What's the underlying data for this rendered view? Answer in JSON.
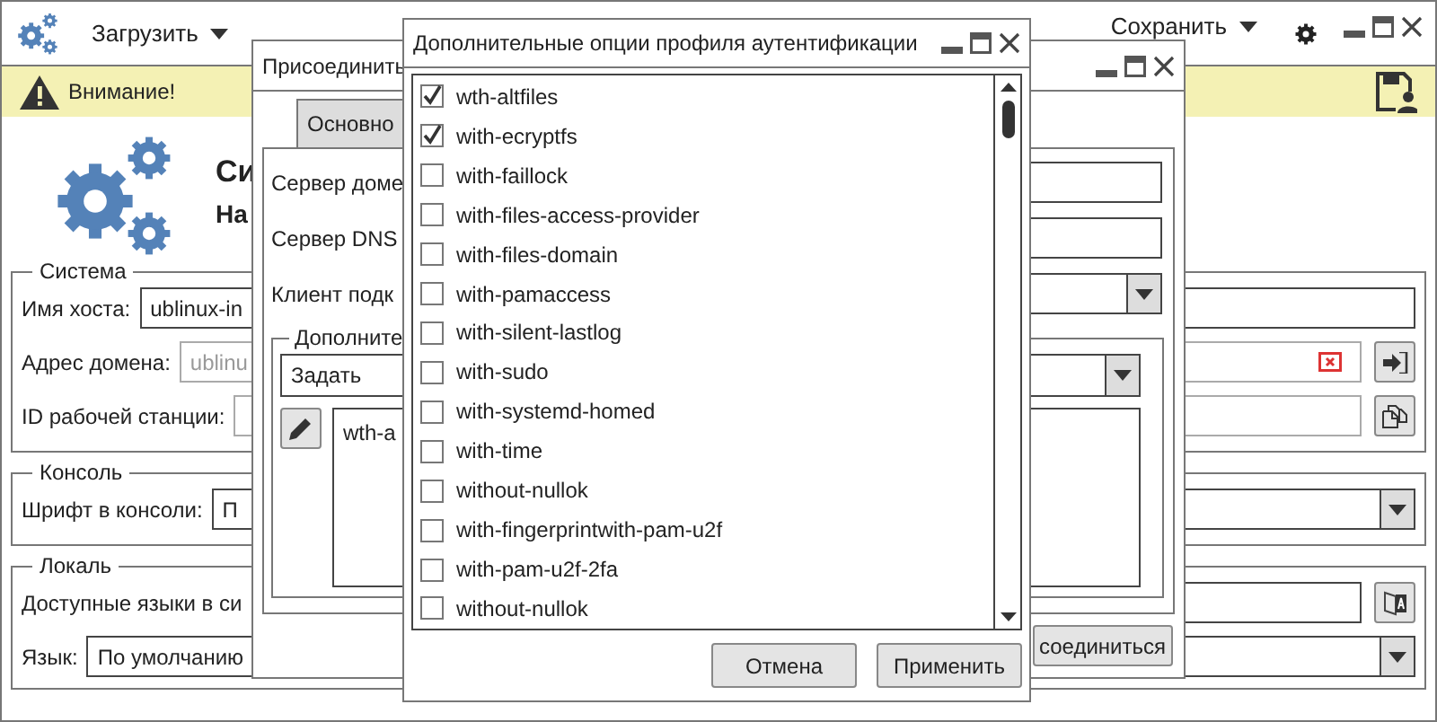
{
  "main": {
    "menu": [
      {
        "label": "Загрузить"
      }
    ],
    "save_menu": {
      "label": "Сохранить"
    },
    "warning": "Внимание!",
    "header_title": "Си",
    "header_subtitle": "На",
    "sections": [
      {
        "title": "Система",
        "rows": [
          {
            "kind": "text",
            "label": "Имя хоста:",
            "value": "ublinux-in"
          },
          {
            "kind": "clearable",
            "label": "Адрес домена:",
            "placeholder": "ublinu"
          },
          {
            "kind": "copy",
            "label": "ID рабочей станции:"
          }
        ]
      },
      {
        "title": "Консоль",
        "rows": [
          {
            "kind": "select",
            "label": "Шрифт в консоли:",
            "value": "П"
          }
        ]
      },
      {
        "title": "Локаль",
        "rows": [
          {
            "kind": "lang",
            "label": "Доступные языки в си"
          },
          {
            "kind": "select",
            "label": "Язык:",
            "value": "По умолчанию"
          }
        ]
      }
    ]
  },
  "join_dialog": {
    "title": "Присоединить",
    "tabs": [
      {
        "label": "Основно",
        "selected": true
      }
    ],
    "fields": [
      {
        "kind": "text",
        "label": "Сервер доме"
      },
      {
        "kind": "text",
        "label": "Сервер DNS"
      },
      {
        "kind": "select",
        "label": "Клиент подк"
      }
    ],
    "group": {
      "title": "Дополните",
      "select_value": "Задать",
      "text": "wth-a"
    },
    "button": "соединиться"
  },
  "auth_dialog": {
    "title": "Дополнительные опции профиля аутентификации",
    "options": [
      {
        "label": "wth-altfiles",
        "checked": true
      },
      {
        "label": "with-ecryptfs",
        "checked": true
      },
      {
        "label": "with-faillock",
        "checked": false
      },
      {
        "label": "with-files-access-provider",
        "checked": false
      },
      {
        "label": "with-files-domain",
        "checked": false
      },
      {
        "label": "with-pamaccess",
        "checked": false
      },
      {
        "label": "with-silent-lastlog",
        "checked": false
      },
      {
        "label": "with-sudo",
        "checked": false
      },
      {
        "label": "with-systemd-homed",
        "checked": false
      },
      {
        "label": "with-time",
        "checked": false
      },
      {
        "label": "without-nullok",
        "checked": false
      },
      {
        "label": "with-fingerprintwith-pam-u2f",
        "checked": false
      },
      {
        "label": "with-pam-u2f-2fa",
        "checked": false
      },
      {
        "label": "without-nullok",
        "checked": false
      }
    ],
    "buttons": [
      "Отмена",
      "Применить"
    ]
  }
}
